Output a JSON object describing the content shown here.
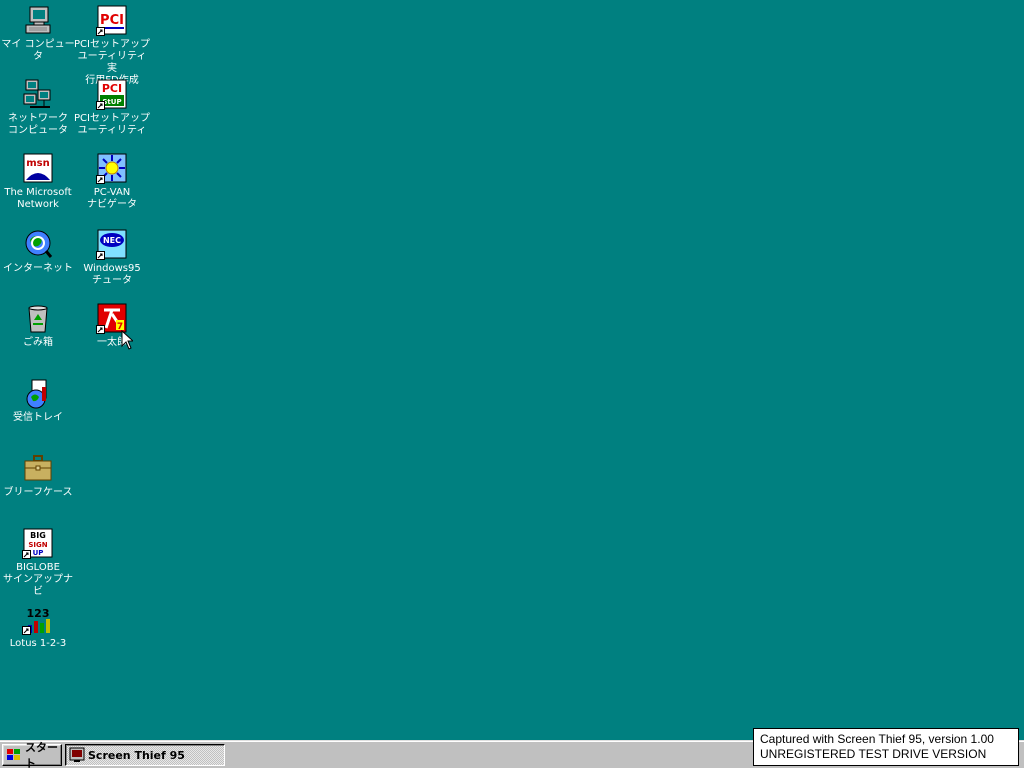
{
  "desktop": {
    "background_color": "#008080",
    "icons": [
      {
        "label": "マイ コンピュータ",
        "icon": "my-computer-icon",
        "shortcut": false
      },
      {
        "label": "ネットワーク\nコンピュータ",
        "icon": "network-computer-icon",
        "shortcut": false
      },
      {
        "label": "The Microsoft\nNetwork",
        "icon": "msn-icon",
        "shortcut": false
      },
      {
        "label": "インターネット",
        "icon": "internet-icon",
        "shortcut": false
      },
      {
        "label": "ごみ箱",
        "icon": "recycle-bin-icon",
        "shortcut": false
      },
      {
        "label": "受信トレイ",
        "icon": "inbox-icon",
        "shortcut": false
      },
      {
        "label": "ブリーフケース",
        "icon": "briefcase-icon",
        "shortcut": false
      },
      {
        "label": "BIGLOBE\nサインアップナビ",
        "icon": "biglobe-signup-icon",
        "shortcut": true
      },
      {
        "label": "Lotus 1-2-3",
        "icon": "lotus-123-icon",
        "shortcut": true
      },
      {
        "label": "PCIセットアップ\nユーティリティ 実\n行用FD作成",
        "icon": "pci-setup-fd-icon",
        "shortcut": true
      },
      {
        "label": "PCIセットアップ\nユーティリティ",
        "icon": "pci-setup-utility-icon",
        "shortcut": true
      },
      {
        "label": "PC-VAN\nナビゲータ",
        "icon": "pc-van-navigator-icon",
        "shortcut": true
      },
      {
        "label": "Windows95\nチュータ",
        "icon": "nec-windows95-tutor-icon",
        "shortcut": true
      },
      {
        "label": "一太郎",
        "icon": "ichitaro-icon",
        "shortcut": true
      }
    ]
  },
  "taskbar": {
    "start_label": "スタート",
    "tasks": [
      {
        "label": "Screen Thief 95",
        "icon": "screen-thief-icon",
        "active": true
      }
    ]
  },
  "watermark": {
    "line1": "Captured with Screen Thief 95, version 1.00",
    "line2": "UNREGISTERED TEST DRIVE VERSION"
  }
}
